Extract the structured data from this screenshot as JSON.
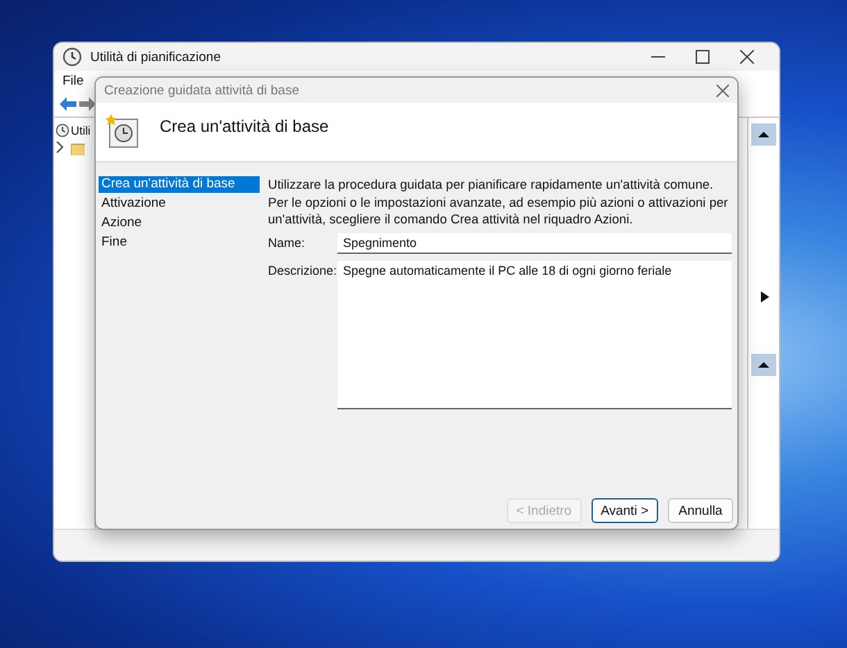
{
  "main_window": {
    "title": "Utilità di pianificazione",
    "menu": [
      "File"
    ],
    "tree": [
      {
        "label": "Utili",
        "expanded": false
      }
    ]
  },
  "wizard": {
    "title": "Creazione guidata attività di base",
    "heading": "Crea un'attività di base",
    "steps": [
      {
        "label": "Crea un'attività di base",
        "selected": true
      },
      {
        "label": "Attivazione",
        "selected": false
      },
      {
        "label": "Azione",
        "selected": false
      },
      {
        "label": "Fine",
        "selected": false
      }
    ],
    "intro": "Utilizzare la procedura guidata per pianificare rapidamente un'attività comune. Per le opzioni o le impostazioni avanzate, ad esempio più azioni o attivazioni per un'attività, scegliere il comando Crea attività nel riquadro Azioni.",
    "fields": [
      {
        "kind": "line",
        "label": "Name:",
        "value": "Spegnimento"
      },
      {
        "kind": "area",
        "label": "Descrizione:",
        "value": "Spegne automaticamente il PC alle 18 di ogni giorno feriale"
      }
    ],
    "buttons": [
      {
        "label": "< Indietro",
        "disabled": true,
        "default": false
      },
      {
        "label": "Avanti >",
        "disabled": false,
        "default": true
      },
      {
        "label": "Annulla",
        "disabled": false,
        "default": false
      }
    ]
  }
}
